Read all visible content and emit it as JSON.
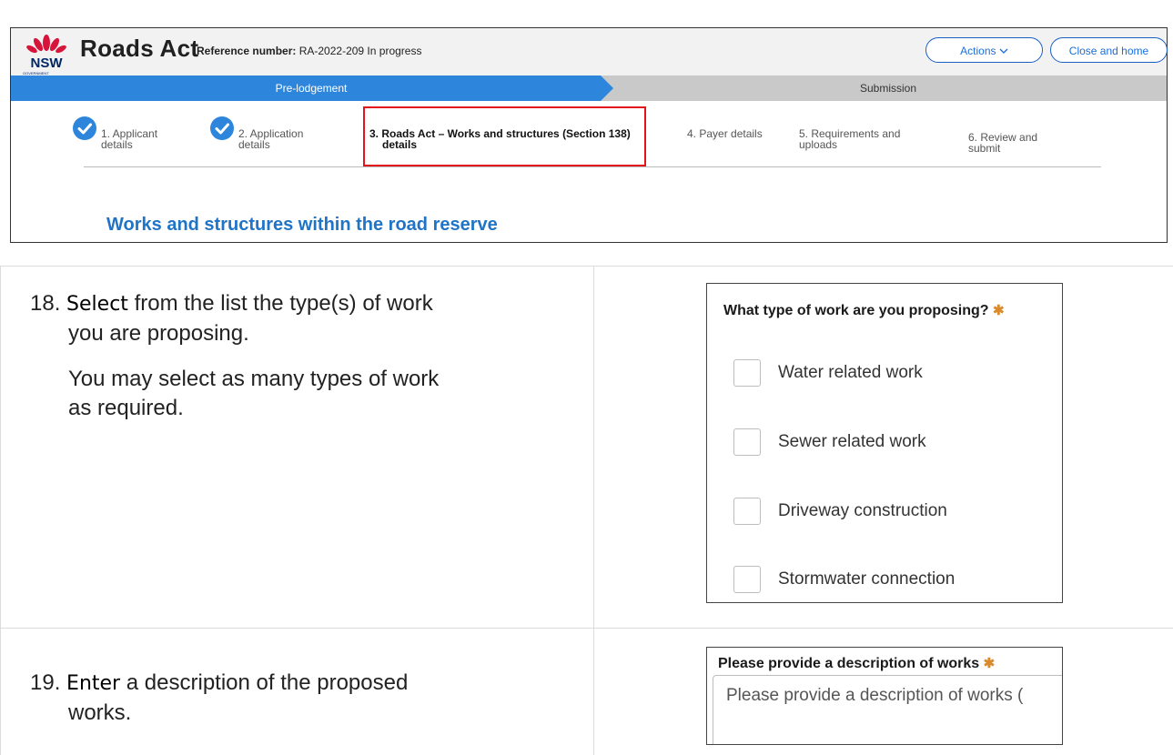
{
  "header": {
    "app_title": "Roads Act",
    "reference_label": "Reference number:",
    "reference_value": "RA-2022-209 In progress",
    "actions_label": "Actions",
    "close_label": "Close and home"
  },
  "stages": [
    {
      "label": "Pre-lodgement",
      "active": true
    },
    {
      "label": "Submission",
      "active": false
    }
  ],
  "steps": [
    {
      "line1": "1. Applicant",
      "line2": "details",
      "complete": true
    },
    {
      "line1": "2. Application",
      "line2": "details",
      "complete": true
    },
    {
      "line1": "3. Roads Act – Works and structures (Section 138)",
      "line2": "details",
      "current": true
    },
    {
      "line1": "4. Payer details",
      "line2": ""
    },
    {
      "line1": "5. Requirements and",
      "line2": "uploads"
    },
    {
      "line1": "6. Review and",
      "line2": "submit"
    }
  ],
  "section_heading": "Works and structures within the road reserve",
  "instructions": [
    {
      "number": "18.",
      "verb": "Select",
      "rest": " from the list the type(s) of work",
      "line2": "you are proposing.",
      "para": "You may select as many types of work",
      "para2": "as required."
    },
    {
      "number": "19.",
      "verb": "Enter",
      "rest": " a description of the proposed",
      "line2": "works."
    }
  ],
  "work_type_question": "What type of work are you proposing?",
  "work_types": [
    "Water related work",
    "Sewer related work",
    "Driveway construction",
    "Stormwater connection"
  ],
  "description_question": "Please provide a description of works",
  "description_placeholder": "Please provide a description of works (",
  "colors": {
    "accent_blue": "#1f74c7",
    "stage_active": "#2e86dc",
    "highlight_red": "#e3141b",
    "required_star": "#d98a2b"
  }
}
